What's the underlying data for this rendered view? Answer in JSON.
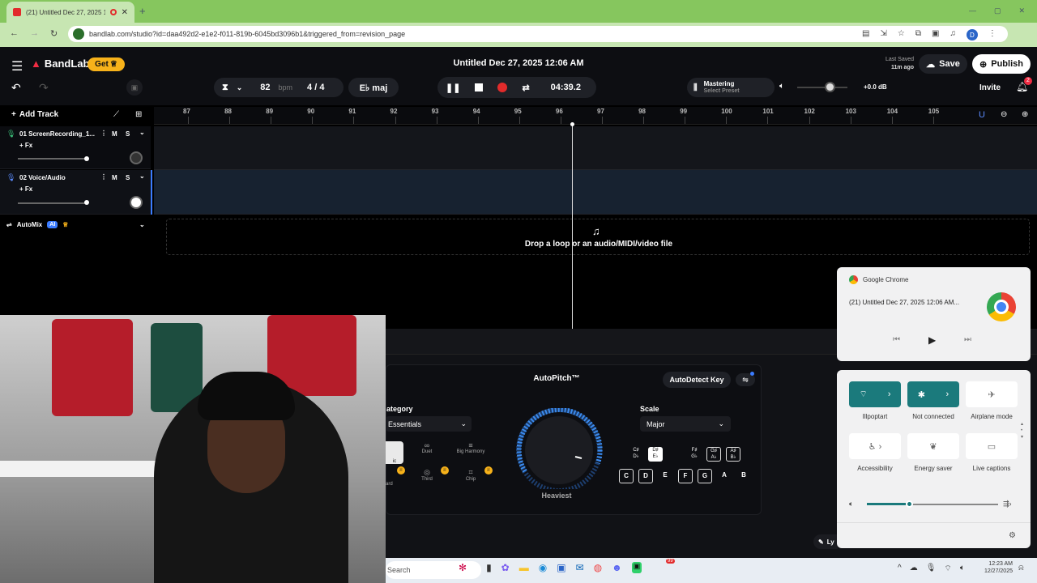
{
  "browser": {
    "tab_title": "(21) Untitled Dec 27, 2025 1",
    "url": "bandlab.com/studio?id=daa492d2-e1e2-f011-819b-6045bd3096b1&triggered_from=revision_page",
    "profile_initial": "D"
  },
  "app": {
    "brand": "BandLab",
    "get_label": "Get",
    "title": "Untitled Dec 27, 2025 12:06 AM",
    "last_saved_label": "Last Saved",
    "last_saved_time": "11m ago",
    "save_label": "Save",
    "publish_label": "Publish",
    "invite_label": "Invite",
    "notification_count": "2",
    "bpm_value": "82",
    "bpm_unit": "bpm",
    "time_signature": "4 / 4",
    "key": "E♭ maj",
    "time_display": "04:39.2",
    "mastering_label": "Mastering",
    "mastering_preset": "Select Preset",
    "volume_db": "+0.0 dB",
    "add_track_label": "Add Track"
  },
  "ruler": [
    "87",
    "88",
    "89",
    "90",
    "91",
    "92",
    "93",
    "94",
    "95",
    "96",
    "97",
    "98",
    "99",
    "100",
    "101",
    "102",
    "103",
    "104",
    "105"
  ],
  "tracks": [
    {
      "name": "01  ScreenRecording_1...",
      "fx": "+ Fx",
      "mute": "M",
      "solo": "S"
    },
    {
      "name": "02  Voice/Audio",
      "fx": "+ Fx",
      "mute": "M",
      "solo": "S"
    }
  ],
  "automix": {
    "label": "AutoMix",
    "badge": "AI"
  },
  "dropzone": {
    "text": "Drop a loop or an audio/MIDI/video file"
  },
  "autopitch": {
    "title": "AutoPitch™",
    "autodetect_label": "AutoDetect Key",
    "category_label": "ategory",
    "category_value": "Essentials",
    "scale_label": "Scale",
    "scale_value": "Major",
    "presets": [
      "Duet",
      "Big Harmony",
      "Third",
      "Chip"
    ],
    "preset_partial": [
      "ic",
      "ard"
    ],
    "knob_label": "Heaviest",
    "sharp_notes": [
      "C♯\nD♭",
      "D♯\nE♭",
      "F♯\nG♭",
      "G♯\nA♭",
      "A♯\nB♭"
    ],
    "natural_notes": [
      "C",
      "D",
      "E",
      "F",
      "G",
      "A",
      "B"
    ],
    "lyrics_partial": "Ly"
  },
  "media_popup": {
    "app_name": "Google Chrome",
    "media_title": "(21) Untitled Dec 27, 2025 12:06 AM..."
  },
  "quick_settings": {
    "tiles": [
      {
        "label": "Illpoptart"
      },
      {
        "label": "Not connected"
      },
      {
        "label": "Airplane mode"
      },
      {
        "label": "Accessibility"
      },
      {
        "label": "Energy saver"
      },
      {
        "label": "Live captions"
      }
    ],
    "volume_level": 0.32
  },
  "taskbar": {
    "search_placeholder": "Search",
    "time": "12:23 AM",
    "date": "12/27/2025",
    "discord_badge": "99"
  },
  "colors": {
    "brand_red": "#f12c43",
    "accent_teal": "#1b7a7c",
    "record_red": "#e22b2b",
    "tab_bar": "#86c65e",
    "get_yellow": "#f7b21a"
  }
}
